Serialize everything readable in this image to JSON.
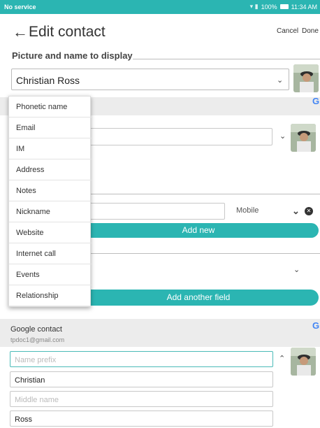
{
  "status_bar": {
    "left": "No service",
    "right": "100%",
    "time": "11:34 AM"
  },
  "header": {
    "back_icon": "←",
    "title": "Edit contact",
    "cancel": "Cancel",
    "done": "Done"
  },
  "picture_section": {
    "title": "Picture and name to display",
    "selected_name": "Christian Ross"
  },
  "menu_items": [
    "Phonetic name",
    "Email",
    "IM",
    "Address",
    "Notes",
    "Nickname",
    "Website",
    "Internet call",
    "Events",
    "Relationship"
  ],
  "phone_row": {
    "type_label": "Mobile"
  },
  "buttons": {
    "add_new": "Add new",
    "add_another_field": "Add another field"
  },
  "google_contact": {
    "label": "Google contact",
    "account": "tpdoc1@gmail.com"
  },
  "name_fields": {
    "prefix_placeholder": "Name prefix",
    "first": "Christian",
    "middle_placeholder": "Middle name",
    "last": "Ross"
  },
  "colors": {
    "accent": "#2bb5b2",
    "band": "#ececec"
  }
}
